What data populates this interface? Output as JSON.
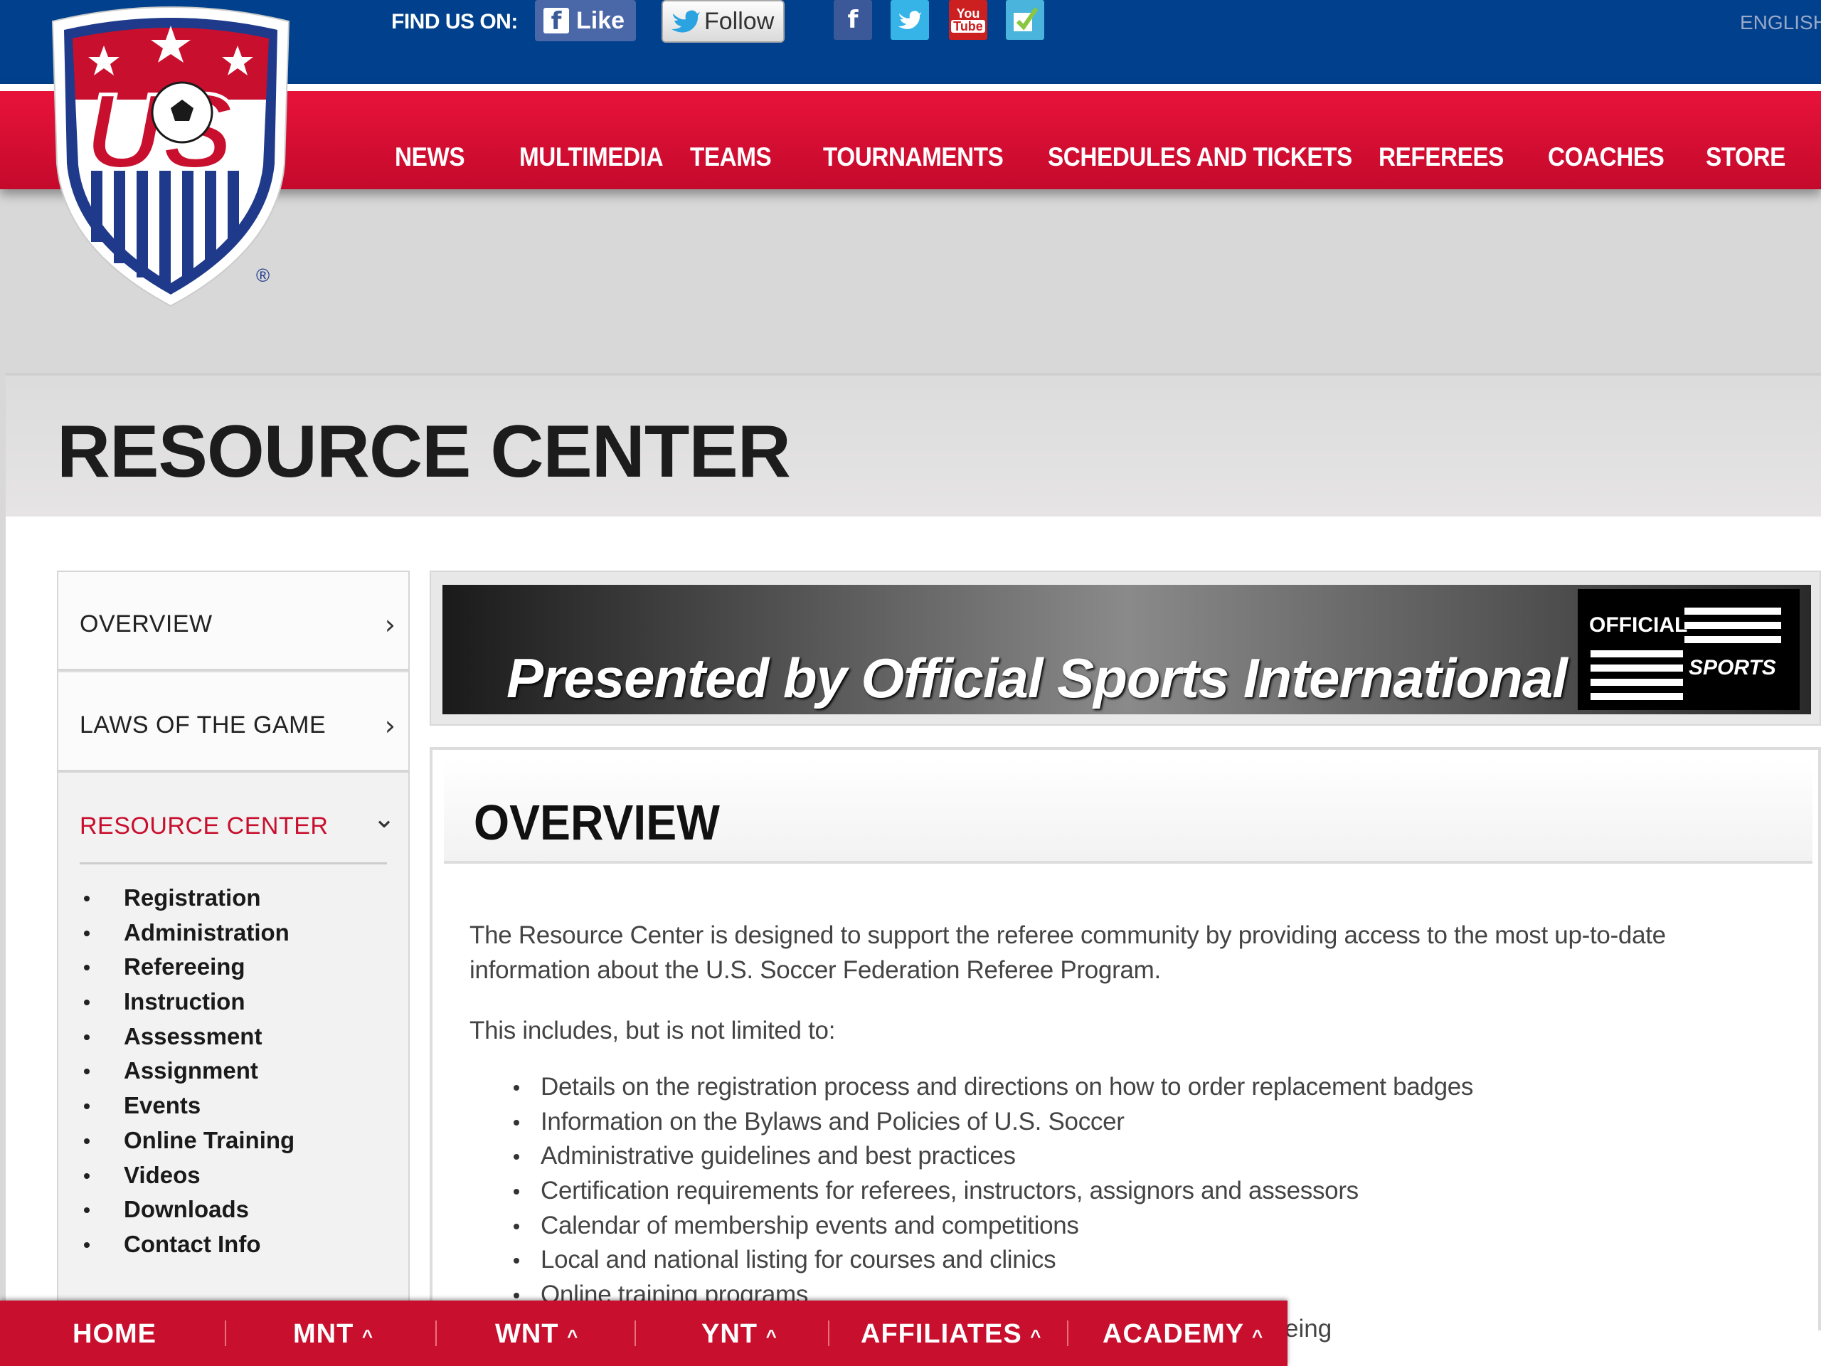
{
  "topbar": {
    "find_us": "FIND US ON:",
    "like": "Like",
    "follow": "Follow",
    "language": "ENGLISH"
  },
  "nav": [
    "NEWS",
    "MULTIMEDIA",
    "TEAMS",
    "TOURNAMENTS",
    "SCHEDULES AND TICKETS",
    "REFEREES",
    "COACHES",
    "STORE"
  ],
  "page_title": "RESOURCE CENTER",
  "sidebar": {
    "sections": [
      "OVERVIEW",
      "LAWS OF THE GAME",
      "RESOURCE CENTER"
    ],
    "items": [
      "Registration",
      "Administration",
      "Refereeing",
      "Instruction",
      "Assessment",
      "Assignment",
      "Events",
      "Online Training",
      "Videos",
      "Downloads",
      "Contact Info"
    ]
  },
  "sponsor": {
    "text": "Presented by Official Sports International",
    "logo_line1": "OFFICIAL",
    "logo_line2": "SPORTS"
  },
  "overview": {
    "title": "OVERVIEW",
    "intro": "The Resource Center is designed to support the referee community by providing access to the most up-to-date information about the U.S. Soccer Federation Referee Program.",
    "includes": "This includes, but is not limited to:",
    "bullets": [
      "Details on the registration process and directions on how to order replacement badges",
      "Information on the Bylaws and Policies of U.S. Soccer",
      "Administrative guidelines and best practices",
      "Certification requirements for referees, instructors, assignors and assessors",
      "Calendar of membership events and competitions",
      "Local and national listing for courses and clinics",
      "Online training programs"
    ],
    "partial": "eing"
  },
  "bottom_nav": [
    "HOME",
    "MNT",
    "WNT",
    "YNT",
    "AFFILIATES",
    "ACADEMY"
  ],
  "colors": {
    "blue": "#00408c",
    "red": "#c8102e"
  }
}
